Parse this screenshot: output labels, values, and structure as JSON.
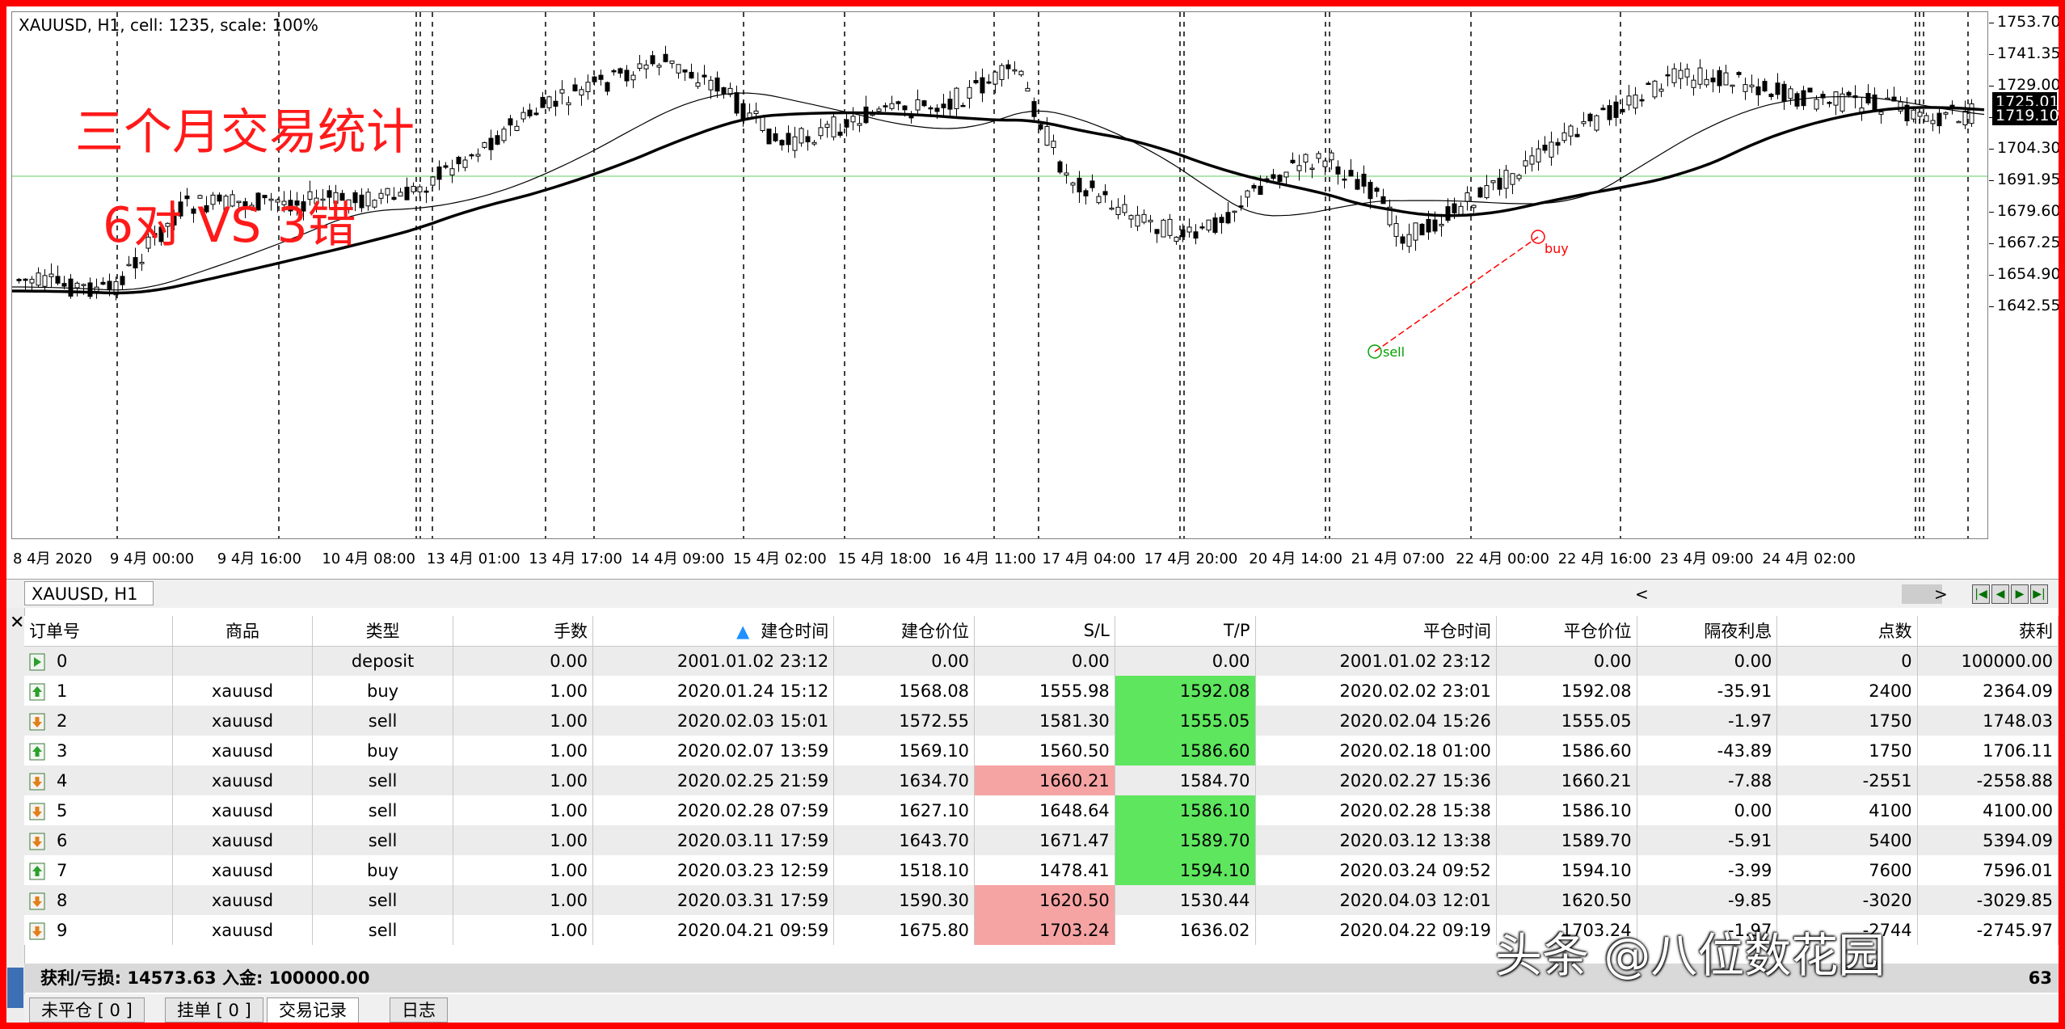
{
  "chart": {
    "info": "XAUUSD, H1, cell: 1235, scale: 100%",
    "annotation_title": "三个月交易统计",
    "annotation_subtitle": "6对 VS 3错",
    "price_levels": [
      "1753.70",
      "1741.35",
      "1729.00",
      "1716.65",
      "1704.30",
      "1691.95",
      "1679.60",
      "1667.25",
      "1654.90",
      "1642.55"
    ],
    "price_tags": [
      "1725.01",
      "1719.10"
    ],
    "time_labels": [
      "8 4月 2020",
      "9 4月 00:00",
      "9 4月 16:00",
      "10 4月 08:00",
      "13 4月 01:00",
      "13 4月 17:00",
      "14 4月 09:00",
      "15 4月 02:00",
      "15 4月 18:00",
      "16 4月 11:00",
      "17 4月 04:00",
      "17 4月 20:00",
      "20 4月 14:00",
      "21 4月 07:00",
      "22 4月 00:00",
      "22 4月 16:00",
      "23 4月 09:00",
      "24 4月 02:00"
    ],
    "order_labels": [
      "sell",
      "buy"
    ],
    "colors": {
      "candle": "#000000",
      "trade_line": "#ff0000",
      "grid_line": "#00aa00"
    }
  },
  "chart_tab": "XAUUSD, H1",
  "scroll": {
    "left": "<",
    "right": ">"
  },
  "table": {
    "columns": [
      "订单号",
      "商品",
      "类型",
      "手数",
      "建仓时间",
      "建仓价位",
      "S/L",
      "T/P",
      "平仓时间",
      "平仓价位",
      "隔夜利息",
      "点数",
      "获利"
    ],
    "sort_indicator": "▲",
    "rows": [
      {
        "id": "0",
        "symbol": "",
        "type": "deposit",
        "lots": "0.00",
        "open_time": "2001.01.02 23:12",
        "open_price": "0.00",
        "sl": "0.00",
        "tp": "0.00",
        "close_time": "2001.01.02 23:12",
        "close_price": "0.00",
        "swap": "0.00",
        "points": "0",
        "profit": "100000.00",
        "icon": "deposit",
        "hit": ""
      },
      {
        "id": "1",
        "symbol": "xauusd",
        "type": "buy",
        "lots": "1.00",
        "open_time": "2020.01.24 15:12",
        "open_price": "1568.08",
        "sl": "1555.98",
        "tp": "1592.08",
        "close_time": "2020.02.02 23:01",
        "close_price": "1592.08",
        "swap": "-35.91",
        "points": "2400",
        "profit": "2364.09",
        "icon": "buy",
        "hit": "tp"
      },
      {
        "id": "2",
        "symbol": "xauusd",
        "type": "sell",
        "lots": "1.00",
        "open_time": "2020.02.03 15:01",
        "open_price": "1572.55",
        "sl": "1581.30",
        "tp": "1555.05",
        "close_time": "2020.02.04 15:26",
        "close_price": "1555.05",
        "swap": "-1.97",
        "points": "1750",
        "profit": "1748.03",
        "icon": "sell",
        "hit": "tp"
      },
      {
        "id": "3",
        "symbol": "xauusd",
        "type": "buy",
        "lots": "1.00",
        "open_time": "2020.02.07 13:59",
        "open_price": "1569.10",
        "sl": "1560.50",
        "tp": "1586.60",
        "close_time": "2020.02.18 01:00",
        "close_price": "1586.60",
        "swap": "-43.89",
        "points": "1750",
        "profit": "1706.11",
        "icon": "buy",
        "hit": "tp"
      },
      {
        "id": "4",
        "symbol": "xauusd",
        "type": "sell",
        "lots": "1.00",
        "open_time": "2020.02.25 21:59",
        "open_price": "1634.70",
        "sl": "1660.21",
        "tp": "1584.70",
        "close_time": "2020.02.27 15:36",
        "close_price": "1660.21",
        "swap": "-7.88",
        "points": "-2551",
        "profit": "-2558.88",
        "icon": "sell",
        "hit": "sl"
      },
      {
        "id": "5",
        "symbol": "xauusd",
        "type": "sell",
        "lots": "1.00",
        "open_time": "2020.02.28 07:59",
        "open_price": "1627.10",
        "sl": "1648.64",
        "tp": "1586.10",
        "close_time": "2020.02.28 15:38",
        "close_price": "1586.10",
        "swap": "0.00",
        "points": "4100",
        "profit": "4100.00",
        "icon": "sell",
        "hit": "tp"
      },
      {
        "id": "6",
        "symbol": "xauusd",
        "type": "sell",
        "lots": "1.00",
        "open_time": "2020.03.11 17:59",
        "open_price": "1643.70",
        "sl": "1671.47",
        "tp": "1589.70",
        "close_time": "2020.03.12 13:38",
        "close_price": "1589.70",
        "swap": "-5.91",
        "points": "5400",
        "profit": "5394.09",
        "icon": "sell",
        "hit": "tp"
      },
      {
        "id": "7",
        "symbol": "xauusd",
        "type": "buy",
        "lots": "1.00",
        "open_time": "2020.03.23 12:59",
        "open_price": "1518.10",
        "sl": "1478.41",
        "tp": "1594.10",
        "close_time": "2020.03.24 09:52",
        "close_price": "1594.10",
        "swap": "-3.99",
        "points": "7600",
        "profit": "7596.01",
        "icon": "buy",
        "hit": "tp"
      },
      {
        "id": "8",
        "symbol": "xauusd",
        "type": "sell",
        "lots": "1.00",
        "open_time": "2020.03.31 17:59",
        "open_price": "1590.30",
        "sl": "1620.50",
        "tp": "1530.44",
        "close_time": "2020.04.03 12:01",
        "close_price": "1620.50",
        "swap": "-9.85",
        "points": "-3020",
        "profit": "-3029.85",
        "icon": "sell",
        "hit": "sl"
      },
      {
        "id": "9",
        "symbol": "xauusd",
        "type": "sell",
        "lots": "1.00",
        "open_time": "2020.04.21 09:59",
        "open_price": "1675.80",
        "sl": "1703.24",
        "tp": "1636.02",
        "close_time": "2020.04.22 09:19",
        "close_price": "1703.24",
        "swap": "-1.97",
        "points": "-2744",
        "profit": "-2745.97",
        "icon": "sell",
        "hit": "sl"
      }
    ]
  },
  "summary": {
    "label": "获利/亏损: 14573.63  入金: 100000.00",
    "profit_tail": "63"
  },
  "bottom_tabs": [
    "未平仓 [ 0 ]",
    "挂单 [ 0 ]",
    "交易记录",
    "日志"
  ],
  "watermark": "头条 @八位数花园"
}
